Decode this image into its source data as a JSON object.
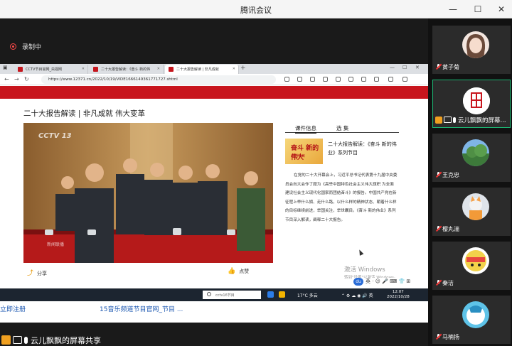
{
  "window": {
    "title": "腾讯会议",
    "minimize": "—",
    "maximize": "☐",
    "close": "✕"
  },
  "recording": {
    "label": "录制中"
  },
  "browser": {
    "tabs": [
      {
        "label": "CCTV节目官网_央视网"
      },
      {
        "label": "二十大报告解读：《奋斗 新的伟"
      },
      {
        "label": "二十大报告解读 | 非凡成就"
      }
    ],
    "new_tab": "+",
    "url": "https://www.12371.cn/2022/10/19/VIDE1666149361771727.shtml"
  },
  "page": {
    "title": "二十大报告解读 | 非凡成就 伟大变革",
    "video_logo": "CCTV 13",
    "video_watermark": "新闻联播",
    "share_label": "分享",
    "like_label": "点赞",
    "tab_info": "课件信息",
    "tab_episodes": "选 集",
    "series_thumb_title": "奋斗 新的伟大",
    "series_thumb_sub": "系列节目",
    "series_title": "二十大报告解读：《奋斗 新的伟业》系列节目",
    "description": "在党的二十大开幕会上，习近平总书记代表第十九届中央委员会向大会作了题为《高举中国特色社会主义伟大旗帜 为全面建设社会主义现代化国家而团结奋斗》的报告。中国共产党在新征程上举什么旗、走什么路，以什么样的精神状态、朝着什么样的目标继续前进，举国关注，举世瞩目。《奋斗 新的伟业》系列节目深入解读，阐释二十大报告。"
  },
  "activation": {
    "title": "激活 Windows",
    "subtitle": "转到\"设置\"以激活 Windows。"
  },
  "ime": {
    "label": "英",
    "icons": "· ☺ 🎤 ⌨ 👕 ⊞"
  },
  "taskbar": {
    "search_placeholder": "cctv16节目",
    "weather": "17°C 多云",
    "time": "12:07",
    "date": "2022/10/28"
  },
  "below_snippet": {
    "left": "立即注册",
    "right": "15音乐频道节目官网_节目 ..."
  },
  "sharer_bar": {
    "label": "云儿飘飘的屏幕共享"
  },
  "participants": [
    {
      "name": "黄子菊"
    },
    {
      "name": "云儿飘飘的屏幕..."
    },
    {
      "name": "王克忠"
    },
    {
      "name": "樱丸湍"
    },
    {
      "name": "秦洁"
    },
    {
      "name": "马楠扬"
    }
  ]
}
